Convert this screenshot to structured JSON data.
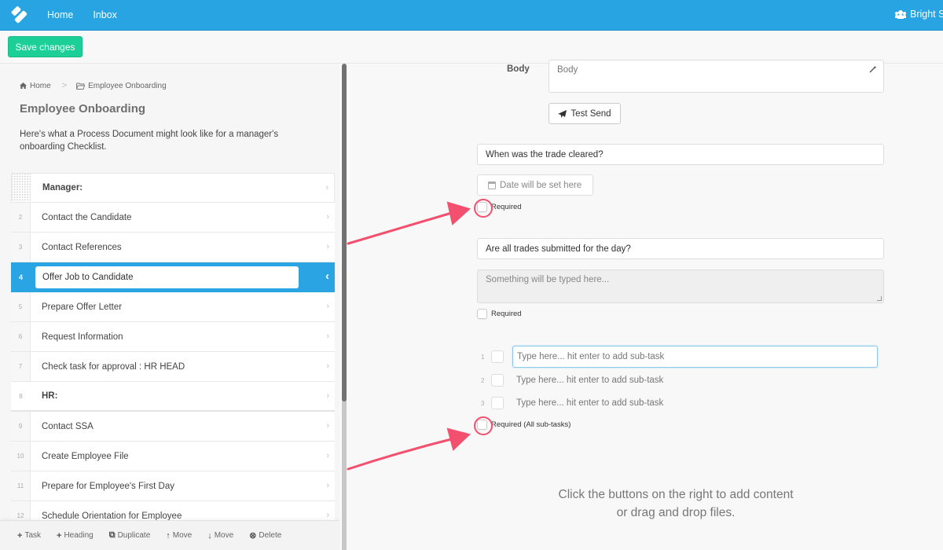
{
  "topbar": {
    "logo": "app-logo",
    "nav": [
      "Home",
      "Inbox"
    ],
    "organization": "Bright St",
    "org_icon": "users-icon"
  },
  "toolbar": {
    "save_label": "Save changes"
  },
  "left": {
    "breadcrumb": {
      "home": "Home",
      "current": "Employee Onboarding"
    },
    "title": "Employee Onboarding",
    "description": "Here's what a Process Document might look like for a manager's onboarding Checklist.",
    "tasks": [
      {
        "num": "",
        "label": "Manager:",
        "type": "heading"
      },
      {
        "num": "2",
        "label": "Contact the Candidate",
        "type": "task"
      },
      {
        "num": "3",
        "label": "Contact References",
        "type": "task"
      },
      {
        "num": "4",
        "label": "Offer Job to Candidate",
        "type": "task",
        "active": true
      },
      {
        "num": "5",
        "label": "Prepare Offer Letter",
        "type": "task"
      },
      {
        "num": "6",
        "label": "Request Information",
        "type": "task"
      },
      {
        "num": "7",
        "label": "Check task for approval : HR HEAD",
        "type": "task"
      },
      {
        "num": "8",
        "label": "HR:",
        "type": "heading"
      },
      {
        "num": "9",
        "label": "Contact SSA",
        "type": "task"
      },
      {
        "num": "10",
        "label": "Create Employee File",
        "type": "task"
      },
      {
        "num": "11",
        "label": "Prepare for Employee's First Day",
        "type": "task"
      },
      {
        "num": "12",
        "label": "Schedule Orientation for Employee",
        "type": "task"
      }
    ],
    "bottom_actions": [
      {
        "icon": "+",
        "label": "Task",
        "name": "add-task-button"
      },
      {
        "icon": "+",
        "label": "Heading",
        "name": "add-heading-button"
      },
      {
        "icon": "⧉",
        "label": "Duplicate",
        "name": "duplicate-button"
      },
      {
        "icon": "↑",
        "label": "Move",
        "name": "move-up-button"
      },
      {
        "icon": "↓",
        "label": "Move",
        "name": "move-down-button"
      },
      {
        "icon": "⊗",
        "label": "Delete",
        "name": "delete-button"
      }
    ]
  },
  "right": {
    "body_label": "Body",
    "body_placeholder": "Body",
    "test_send_label": "Test Send",
    "date_question": "When was the trade cleared?",
    "date_placeholder": "Date will be set here",
    "required_label": "Required",
    "text_question": "Are all trades submitted for the day?",
    "text_placeholder": "Something will be typed here...",
    "subtasks": [
      {
        "num": "1",
        "placeholder": "Type here... hit enter to add sub-task"
      },
      {
        "num": "2",
        "placeholder": "Type here... hit enter to add sub-task"
      },
      {
        "num": "3",
        "placeholder": "Type here... hit enter to add sub-task"
      }
    ],
    "required_all_label": "Required (All sub-tasks)",
    "hint_line1": "Click the buttons on the right to add content",
    "hint_line2": "or drag and drop files."
  },
  "colors": {
    "brand": "#28a4e2",
    "save": "#1ccf96",
    "annotation": "#f2506e"
  }
}
